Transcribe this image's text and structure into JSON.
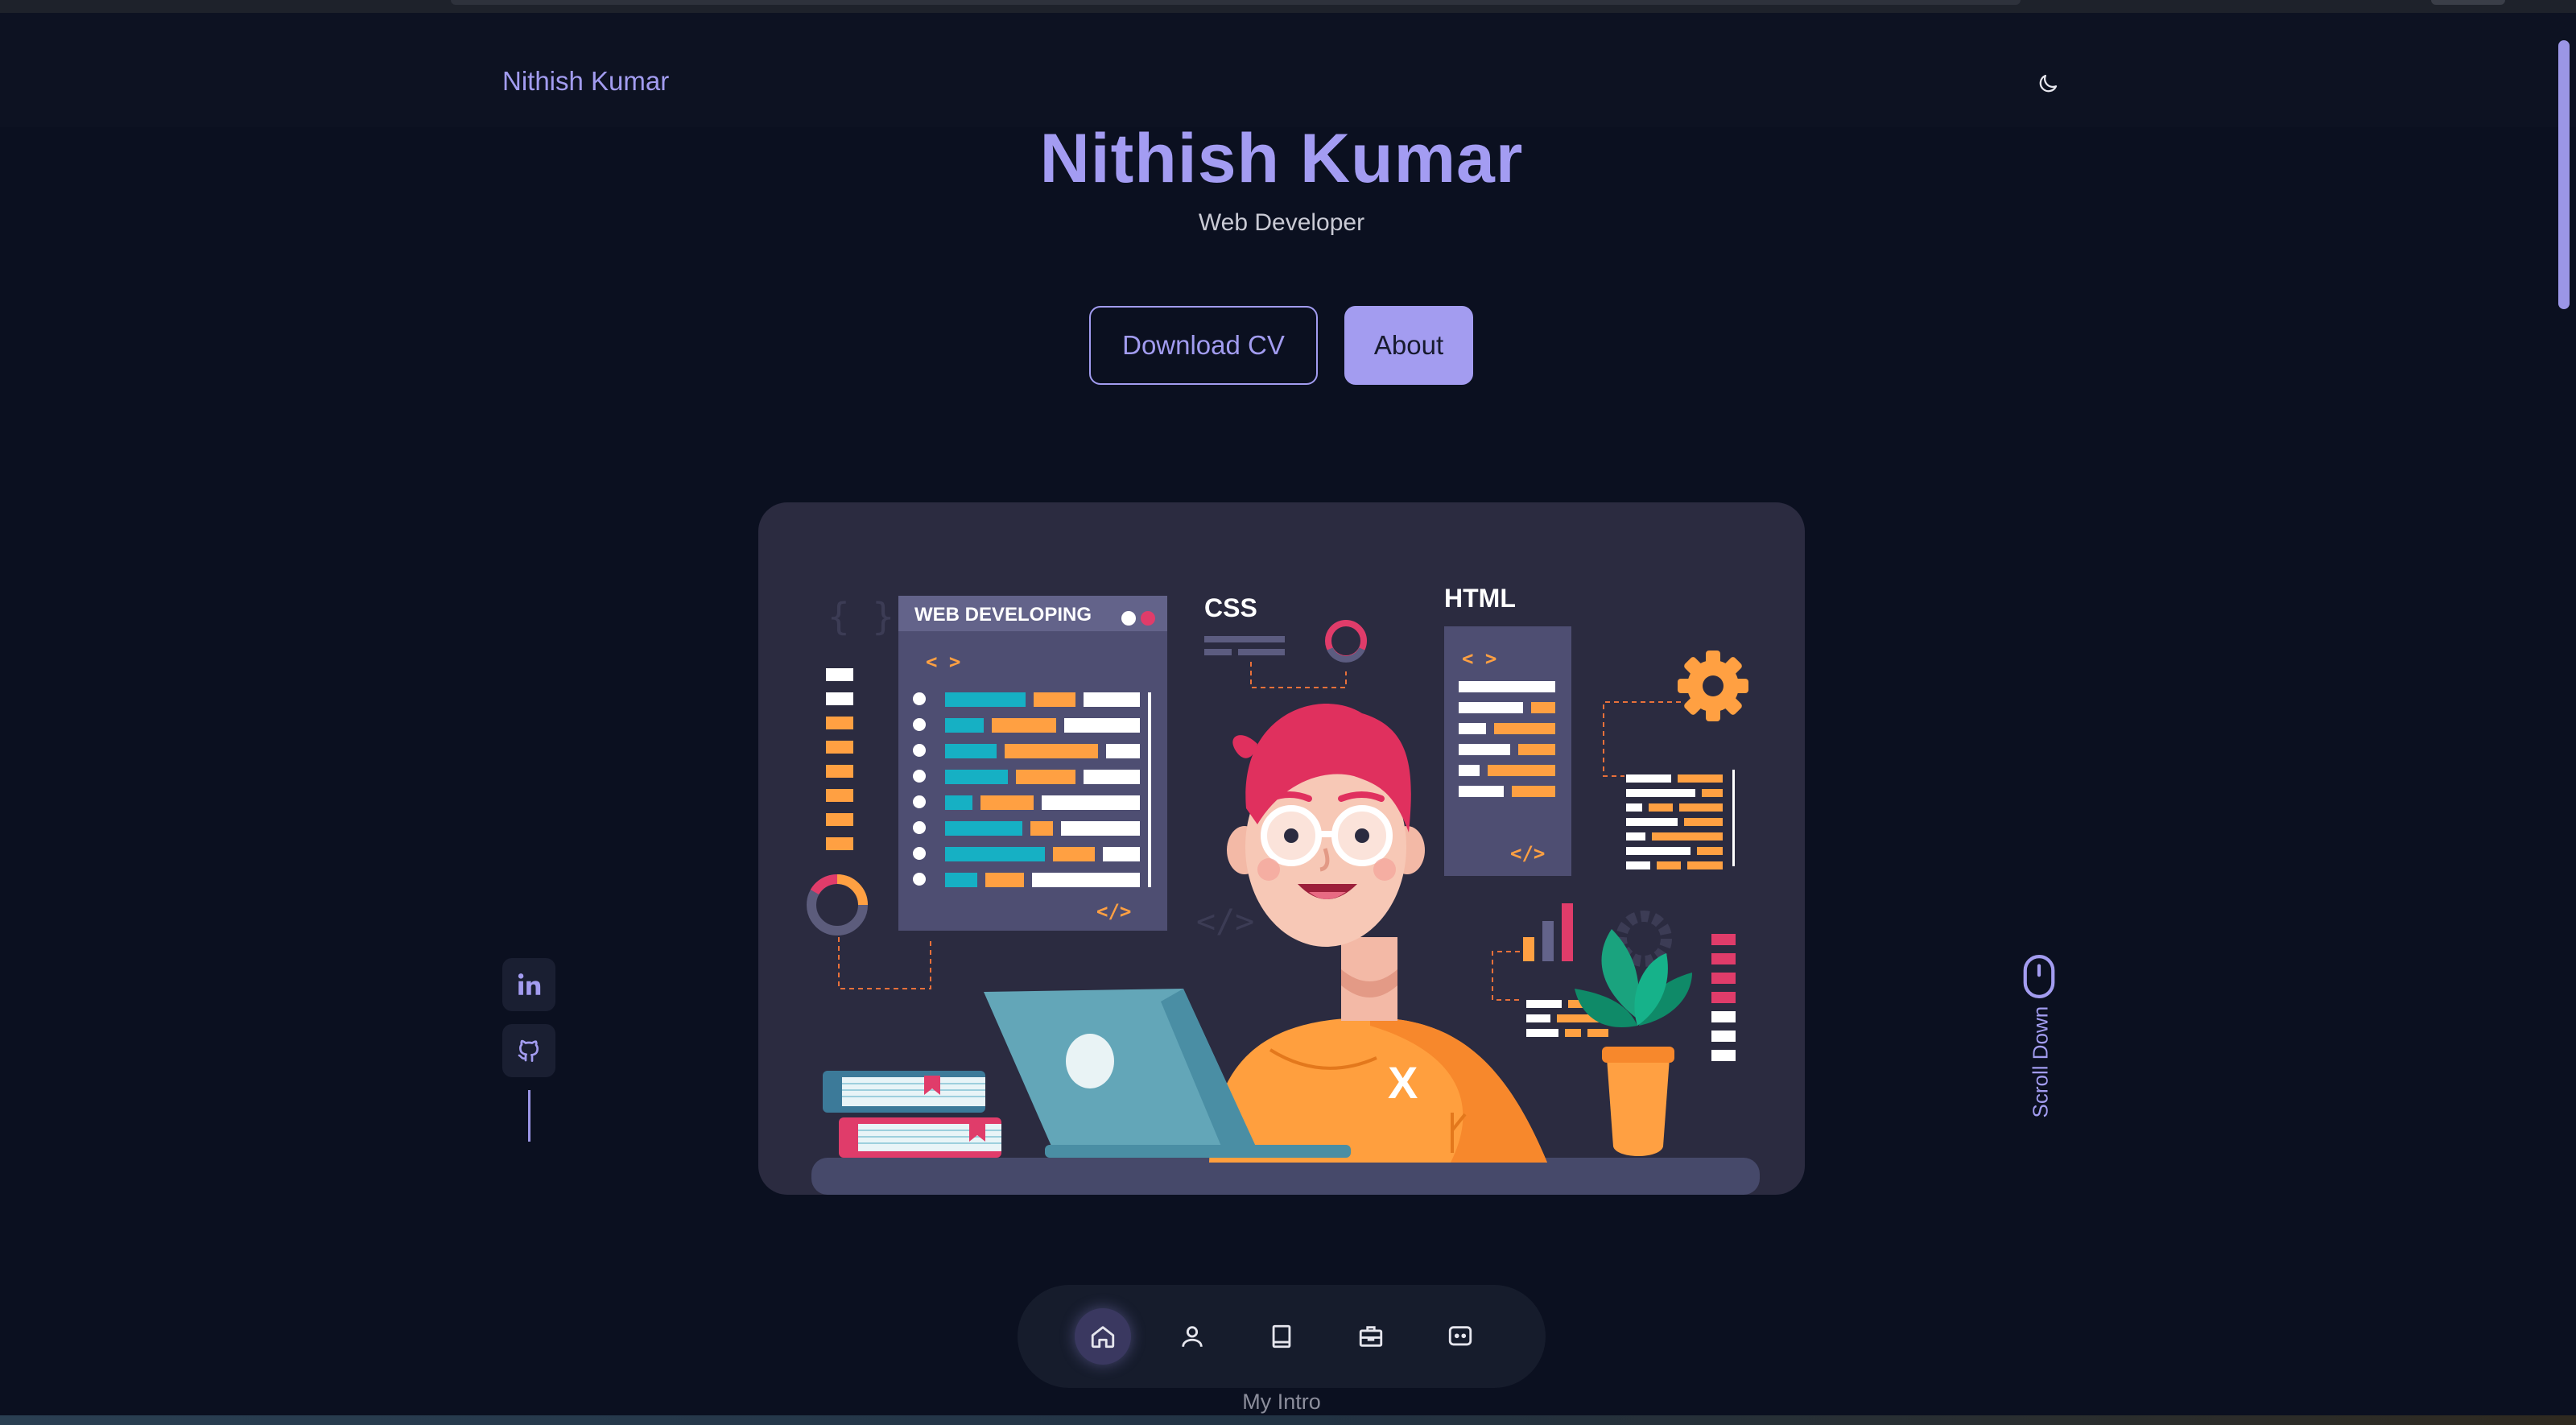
{
  "header": {
    "brand": "Nithish Kumar",
    "theme_toggle_icon": "moon-icon"
  },
  "hero": {
    "name": "Nithish Kumar",
    "title": "Web Developer",
    "buttons": {
      "download_cv": "Download CV",
      "about": "About"
    }
  },
  "illustration": {
    "web_panel_title": "WEB DEVELOPING",
    "css_label": "CSS",
    "html_label": "HTML",
    "open_tag": "< >",
    "close_tag": "</>",
    "shirt_letter": "X"
  },
  "social": {
    "linkedin_icon": "linkedin-icon",
    "github_icon": "github-icon"
  },
  "scroll": {
    "label": "Scroll Down",
    "icon": "mouse-icon"
  },
  "bottom_nav": {
    "items": [
      {
        "icon": "home-icon",
        "active": true
      },
      {
        "icon": "user-icon",
        "active": false
      },
      {
        "icon": "book-icon",
        "active": false
      },
      {
        "icon": "briefcase-icon",
        "active": false
      },
      {
        "icon": "message-icon",
        "active": false
      }
    ],
    "caption": "My Intro"
  },
  "colors": {
    "accent": "#a39cf0",
    "background": "#0b1020",
    "card": "#2b2b40",
    "orange": "#ffa042",
    "teal": "#16b0c4",
    "pink": "#e03c6a"
  }
}
